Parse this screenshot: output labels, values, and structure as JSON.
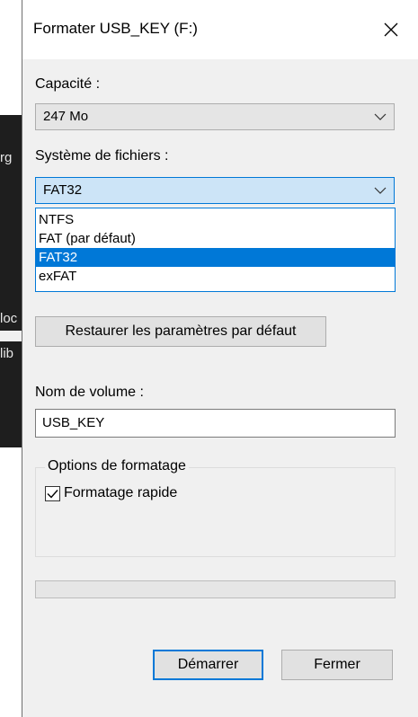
{
  "background_window": {
    "text_fragments": [
      "rg",
      "loc",
      "lib"
    ]
  },
  "dialog": {
    "title": "Formater USB_KEY (F:)",
    "close_icon": "close-x-icon",
    "capacity": {
      "label": "Capacité :",
      "value": "247 Mo"
    },
    "filesystem": {
      "label": "Système de fichiers :",
      "value": "FAT32",
      "options": [
        {
          "label": "NTFS",
          "selected": false
        },
        {
          "label": "FAT (par défaut)",
          "selected": false
        },
        {
          "label": "FAT32",
          "selected": true
        },
        {
          "label": "exFAT",
          "selected": false
        }
      ]
    },
    "restore_defaults_label": "Restaurer les paramètres par défaut",
    "volume": {
      "label": "Nom de volume :",
      "value": "USB_KEY"
    },
    "format_options": {
      "legend": "Options de formatage",
      "quick_format_label": "Formatage rapide",
      "quick_format_checked": true
    },
    "progress": 0,
    "start_label": "Démarrer",
    "close_label": "Fermer"
  },
  "colors": {
    "accent": "#0078d7",
    "dialog_bg": "#f0f0f0",
    "title_bg": "#ffffff",
    "combo_active_bg": "#cce4f7",
    "background_window": "#1e1e1e"
  }
}
